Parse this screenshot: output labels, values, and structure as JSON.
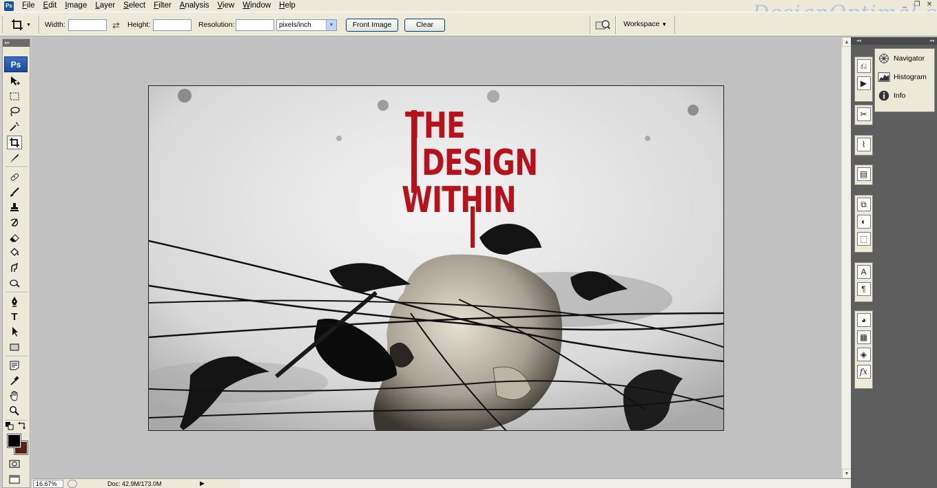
{
  "menubar": {
    "items": [
      "File",
      "Edit",
      "Image",
      "Layer",
      "Select",
      "Filter",
      "Analysis",
      "View",
      "Window",
      "Help"
    ],
    "watermark": "DesignOptimal.com",
    "window_controls": [
      "_",
      "❐",
      "✕"
    ]
  },
  "options": {
    "width_label": "Width:",
    "width_value": "",
    "height_label": "Height:",
    "height_value": "",
    "resolution_label": "Resolution:",
    "resolution_value": "",
    "units_selected": "pixels/inch",
    "front_image_label": "Front Image",
    "clear_label": "Clear",
    "workspace_label": "Workspace"
  },
  "toolbox": {
    "logo": "Ps",
    "type_tool_glyph": "T",
    "foreground_color": "#000000",
    "background_color": "#5a1f15"
  },
  "document": {
    "poster_line1": "THE",
    "poster_line2": "DESIGN",
    "poster_line3": "WITHIN",
    "title_color": "#b5121b"
  },
  "status": {
    "zoom": "16.67%",
    "doc_info": "Doc: 42.9M/173.0M"
  },
  "panels": {
    "items": [
      {
        "label": "Navigator",
        "icon": "navigator-icon"
      },
      {
        "label": "Histogram",
        "icon": "histogram-icon"
      },
      {
        "label": "Info",
        "icon": "info-icon"
      }
    ]
  }
}
